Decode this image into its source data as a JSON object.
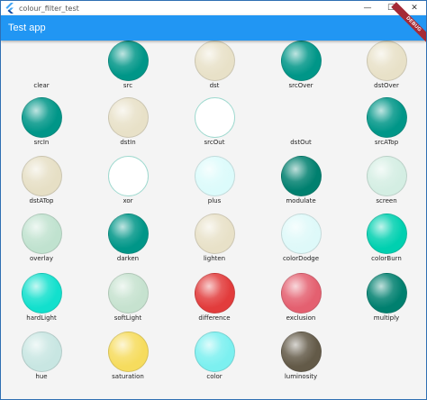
{
  "window": {
    "title": "colour_filter_test",
    "minimize": "—",
    "maximize": "☐",
    "close": "✕"
  },
  "appbar": {
    "title": "Test app",
    "debug_banner": "DEBUG"
  },
  "modes": [
    {
      "label": "clear",
      "color": "none"
    },
    {
      "label": "src",
      "color": "#009688"
    },
    {
      "label": "dst",
      "color": "#e8e1c8"
    },
    {
      "label": "srcOver",
      "color": "#009688"
    },
    {
      "label": "dstOver",
      "color": "#e8e1c8"
    },
    {
      "label": "srcIn",
      "color": "#009688"
    },
    {
      "label": "dstIn",
      "color": "#e8e1c8"
    },
    {
      "label": "srcOut",
      "color": "outline"
    },
    {
      "label": "dstOut",
      "color": "none"
    },
    {
      "label": "srcATop",
      "color": "#009688"
    },
    {
      "label": "dstATop",
      "color": "#e6dfc5"
    },
    {
      "label": "xor",
      "color": "outline"
    },
    {
      "label": "plus",
      "color": "#dcfbfb"
    },
    {
      "label": "modulate",
      "color": "#00806f"
    },
    {
      "label": "screen",
      "color": "#d4eee3"
    },
    {
      "label": "overlay",
      "color": "#c0e2cf"
    },
    {
      "label": "darken",
      "color": "#009688"
    },
    {
      "label": "lighten",
      "color": "#e8e1c8"
    },
    {
      "label": "colorDodge",
      "color": "#def9f9"
    },
    {
      "label": "colorBurn",
      "color": "#00d0b0"
    },
    {
      "label": "hardLight",
      "color": "#12e0cd"
    },
    {
      "label": "softLight",
      "color": "#c6e2cf"
    },
    {
      "label": "difference",
      "color": "#e23c3c"
    },
    {
      "label": "exclusion",
      "color": "#e46070"
    },
    {
      "label": "multiply",
      "color": "#00806f"
    },
    {
      "label": "hue",
      "color": "#c8e6e2"
    },
    {
      "label": "saturation",
      "color": "#f6dc5e"
    },
    {
      "label": "color",
      "color": "#7cf0f0"
    },
    {
      "label": "luminosity",
      "color": "#635a48"
    }
  ]
}
